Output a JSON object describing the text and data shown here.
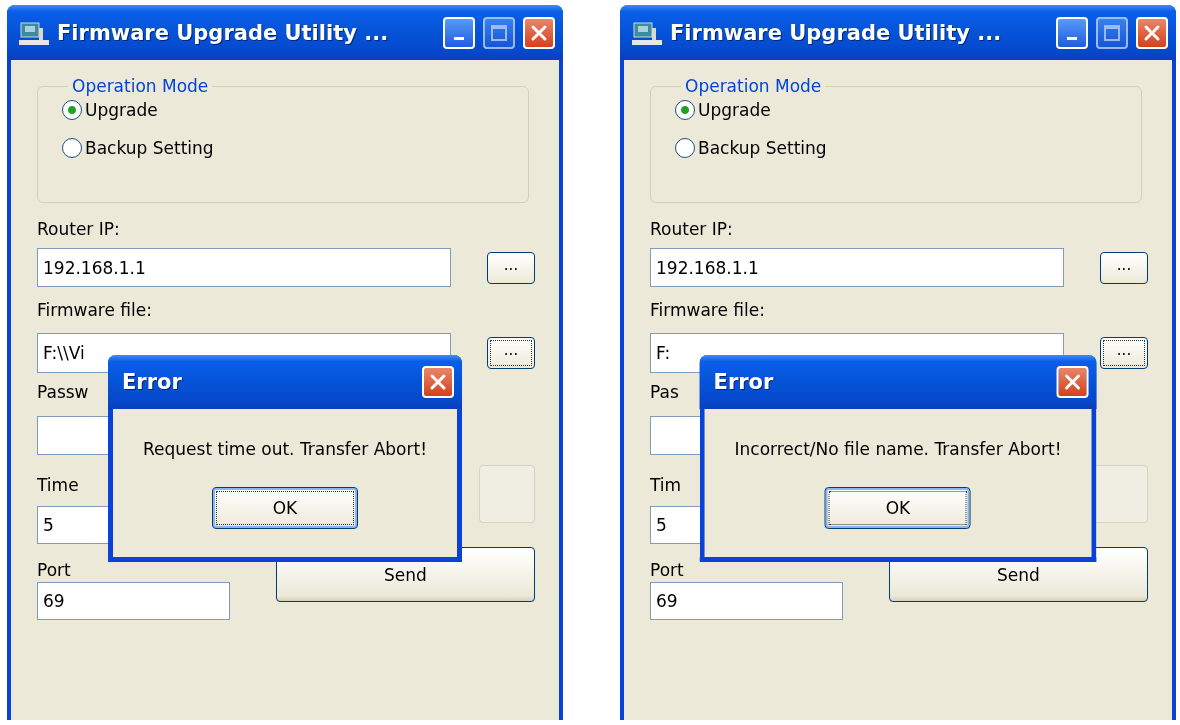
{
  "windows": [
    {
      "title": "Firmware Upgrade Utility ...",
      "operation_mode": {
        "legend": "Operation Mode",
        "options": [
          {
            "label": "Upgrade",
            "selected": true
          },
          {
            "label": "Backup Setting",
            "selected": false
          }
        ]
      },
      "router_ip": {
        "label": "Router IP:",
        "value": "192.168.1.1",
        "browse": "..."
      },
      "firmware_file": {
        "label": "Firmware file:",
        "value": "F:\\\\Vi",
        "browse": "...",
        "focused": true
      },
      "password": {
        "label": "Passw"
      },
      "time_out": {
        "label": "Time",
        "value": "5"
      },
      "port": {
        "label": "Port",
        "value": "69"
      },
      "side_button": {
        "disabled": true
      },
      "send_button": "Send",
      "dialog": {
        "title": "Error",
        "message": "Request time out. Transfer Abort!",
        "button": "OK"
      }
    },
    {
      "title": "Firmware Upgrade Utility ...",
      "operation_mode": {
        "legend": "Operation Mode",
        "options": [
          {
            "label": "Upgrade",
            "selected": true
          },
          {
            "label": "Backup Setting",
            "selected": false
          }
        ]
      },
      "router_ip": {
        "label": "Router IP:",
        "value": "192.168.1.1",
        "browse": "..."
      },
      "firmware_file": {
        "label": "Firmware file:",
        "value": "F:",
        "browse": "...",
        "focused": true
      },
      "password": {
        "label": "Pas"
      },
      "time_out": {
        "label": "Tim",
        "value": "5"
      },
      "port": {
        "label": "Port",
        "value": "69"
      },
      "side_button": {
        "disabled": true
      },
      "send_button": "Send",
      "dialog": {
        "title": "Error",
        "message": "Incorrect/No file name. Transfer Abort!",
        "button": "OK"
      }
    }
  ]
}
